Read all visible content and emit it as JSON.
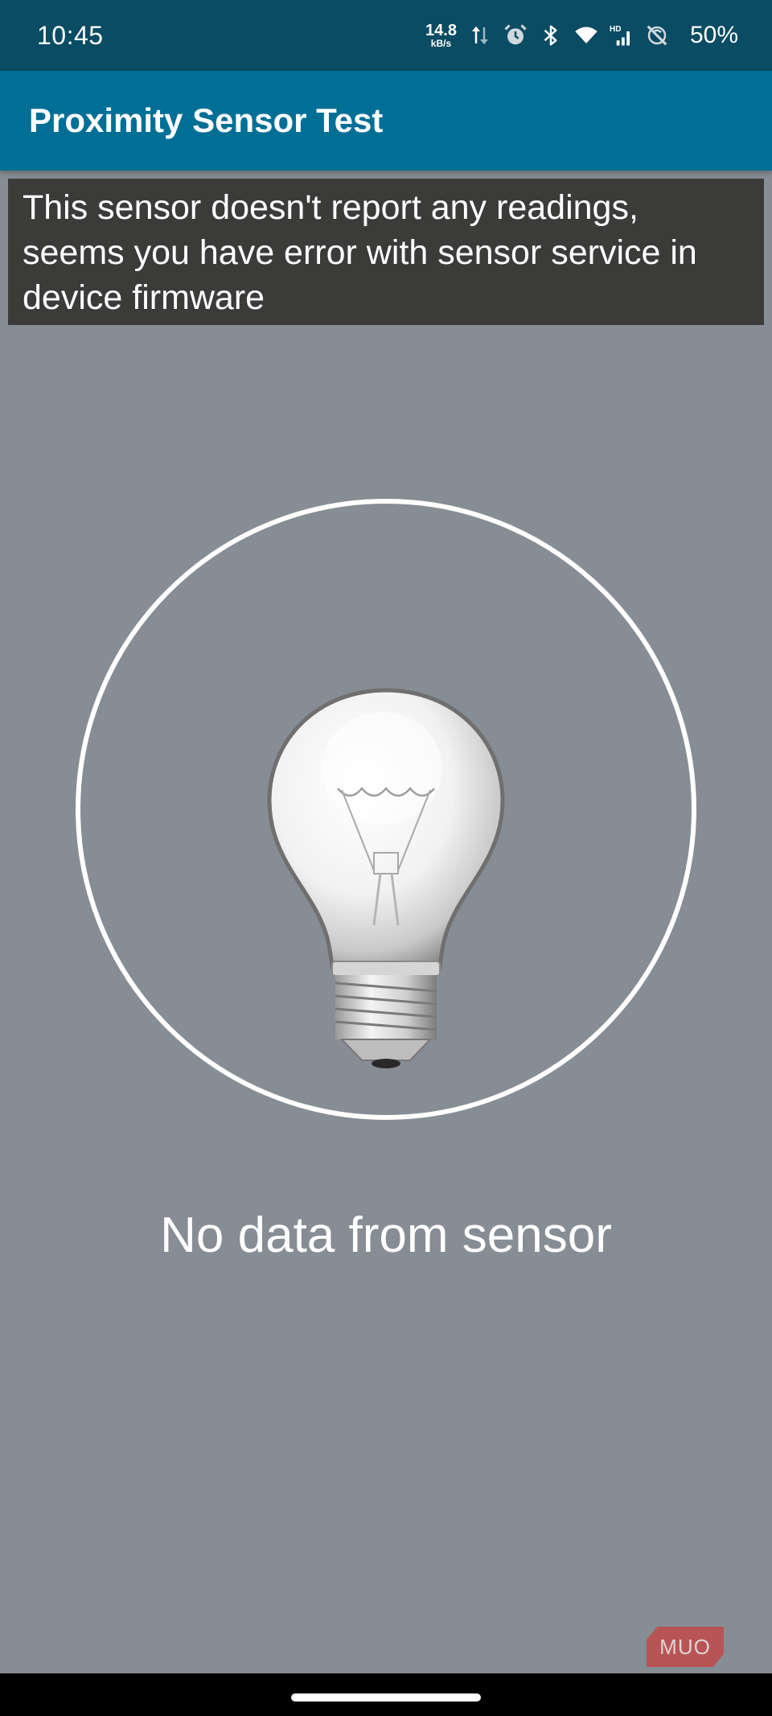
{
  "status_bar": {
    "time": "10:45",
    "net_speed_value": "14.8",
    "net_speed_unit": "kB/s",
    "battery": "50%",
    "icons": [
      "data-arrows-icon",
      "alarm-icon",
      "bluetooth-icon",
      "wifi-icon",
      "hd-signal-icon",
      "nfc-off-icon"
    ]
  },
  "app_bar": {
    "title": "Proximity Sensor Test"
  },
  "banner": {
    "message": "This sensor doesn't report any readings, seems you have error with sensor service in device firmware"
  },
  "sensor": {
    "icon": "light-bulb-icon",
    "status": "No data from sensor"
  },
  "watermark": {
    "text": "MUO"
  },
  "colors": {
    "status_bar": "#0a4c63",
    "app_bar": "#006f96",
    "background": "#878d94",
    "banner": "#3b3c3a",
    "watermark": "#c04a4a"
  }
}
